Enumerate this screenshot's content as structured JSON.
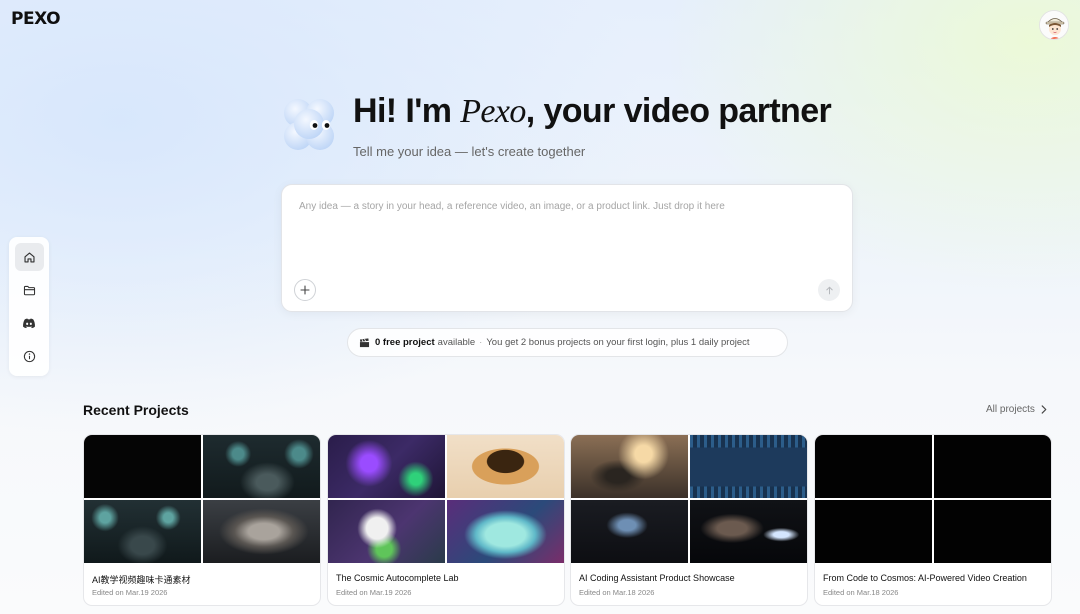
{
  "app": {
    "logo": "PEXO"
  },
  "colors": {
    "accent": "#111111",
    "page_bg": "#eef4fb",
    "blob": "#cfe0fb"
  },
  "sidebar": {
    "items": [
      {
        "icon": "home-icon",
        "active": true
      },
      {
        "icon": "folder-icon",
        "active": false
      },
      {
        "icon": "discord-icon",
        "active": false
      },
      {
        "icon": "info-icon",
        "active": false
      }
    ]
  },
  "hero": {
    "title_prefix": "Hi! I'm ",
    "title_brand": "Pexo",
    "title_suffix": ", your video partner",
    "subtitle": "Tell me your idea — let's create together"
  },
  "prompt": {
    "placeholder": "Any idea — a story in your head, a reference video, an image, or a product link. Just drop it here",
    "value": ""
  },
  "promo": {
    "icon": "clapperboard-icon",
    "count_label": "0 free project",
    "available": "available",
    "separator": "·",
    "details": "You get 2 bonus projects on your first login, plus 1 daily project"
  },
  "recent": {
    "title": "Recent Projects",
    "all_projects": "All projects",
    "projects": [
      {
        "title": "AI教学视频趣味卡通素材",
        "date": "Edited on Mar.19 2026"
      },
      {
        "title": "The Cosmic Autocomplete Lab",
        "date": "Edited on Mar.19 2026"
      },
      {
        "title": "AI Coding Assistant Product Showcase",
        "date": "Edited on Mar.18 2026"
      },
      {
        "title": "From Code to Cosmos: AI-Powered Video Creation",
        "date": "Edited on Mar.18 2026"
      }
    ]
  }
}
